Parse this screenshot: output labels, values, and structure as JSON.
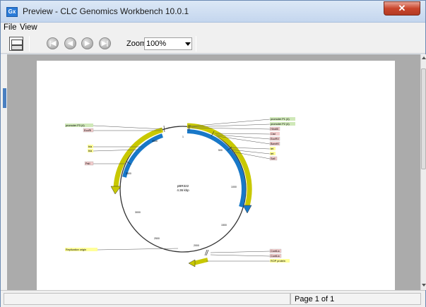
{
  "window": {
    "title": "Preview - CLC Genomics Workbench 10.0.1",
    "app_icon_text": "Gx",
    "close_glyph": "✕"
  },
  "menu": {
    "items": [
      "File",
      "View"
    ]
  },
  "toolbar": {
    "print_icon": "print-icon",
    "nav_buttons": [
      {
        "name": "first-page-icon",
        "glyph": "|◀"
      },
      {
        "name": "previous-page-icon",
        "glyph": "◀"
      },
      {
        "name": "next-page-icon",
        "glyph": "▶"
      },
      {
        "name": "last-page-icon",
        "glyph": "▶|"
      }
    ],
    "zoom_label": "Zoom",
    "zoom_value": "100%"
  },
  "map": {
    "plasmid_name": "pBR322",
    "plasmid_length": "4.36 kbp",
    "ticks": [
      "4000",
      "3500",
      "3000",
      "2500",
      "2000",
      "1500",
      "1000",
      "500",
      "1"
    ],
    "features": [
      {
        "label": "promoter P1 (4)",
        "color": "#cfe8b8"
      },
      {
        "label": "promoter P2 (4)",
        "color": "#cfe8b8"
      },
      {
        "label": "HindIII",
        "color": "#f2cccc"
      },
      {
        "label": "ClaI",
        "color": "#f2cccc"
      },
      {
        "label": "EcoRV",
        "color": "#f2cccc"
      },
      {
        "label": "BamHI",
        "color": "#f2cccc"
      },
      {
        "label": "tet",
        "color": "#ffff99"
      },
      {
        "label": "tet",
        "color": "#ffff99"
      },
      {
        "label": "SalI",
        "color": "#f2cccc"
      },
      {
        "label": "promoter P3 (4)",
        "color": "#cfe8b8"
      },
      {
        "label": "EcoRI",
        "color": "#f2cccc"
      },
      {
        "label": "bla",
        "color": "#ffff99"
      },
      {
        "label": "bla",
        "color": "#ffff99"
      },
      {
        "label": "PstI",
        "color": "#f2cccc"
      },
      {
        "label": "Replication origin",
        "color": "#ffff99"
      },
      {
        "label": "ConfLic",
        "color": "#f2cccc"
      },
      {
        "label": "ConfLic",
        "color": "#f2cccc"
      },
      {
        "label": "ROP protein",
        "color": "#ffff99"
      }
    ]
  },
  "status": {
    "page_info": "Page 1 of 1"
  }
}
